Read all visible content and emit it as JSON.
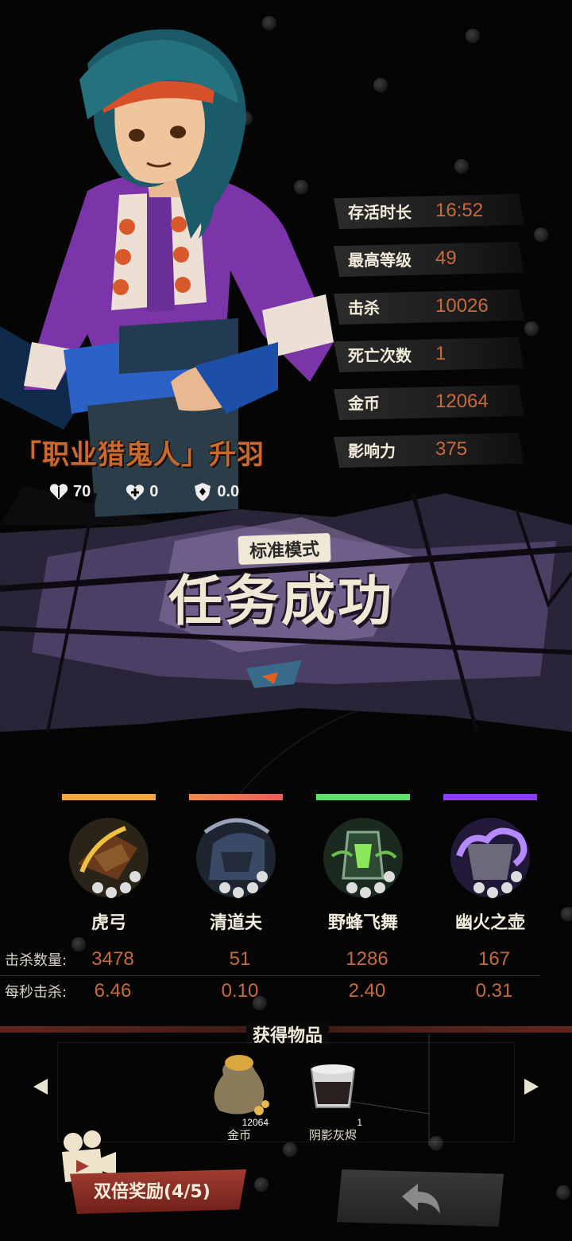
{
  "character": {
    "name": "「职业猎鬼人」升羽",
    "attributes": [
      {
        "icon": "heart-shield-icon",
        "value": "70"
      },
      {
        "icon": "heal-cross-icon",
        "value": "0"
      },
      {
        "icon": "armor-shield-icon",
        "value": "0.0"
      }
    ]
  },
  "stats": [
    {
      "label": "存活时长",
      "value": "16:52"
    },
    {
      "label": "最高等级",
      "value": "49"
    },
    {
      "label": "击杀",
      "value": "10026"
    },
    {
      "label": "死亡次数",
      "value": "1"
    },
    {
      "label": "金币",
      "value": "12064"
    },
    {
      "label": "影响力",
      "value": "375"
    }
  ],
  "result": {
    "mode": "标准模式",
    "title": "任务成功"
  },
  "weapons": [
    {
      "name": "虎弓",
      "color": "#f4a83a",
      "kills": "3478",
      "kps": "6.46"
    },
    {
      "name": "清道夫",
      "color": "#f06a4a",
      "kills": "51",
      "kps": "0.10"
    },
    {
      "name": "野蜂飞舞",
      "color": "#5de26a",
      "kills": "1286",
      "kps": "2.40"
    },
    {
      "name": "幽火之壶",
      "color": "#8a3ef0",
      "kills": "167",
      "kps": "0.31"
    }
  ],
  "kill_table": {
    "kills_label": "击杀数量:",
    "kps_label": "每秒击杀:"
  },
  "items": {
    "title": "获得物品",
    "list": [
      {
        "name": "金币",
        "count": "12064",
        "icon": "coin-bag-icon"
      },
      {
        "name": "阴影灰烬",
        "count": "1",
        "icon": "ash-jar-icon"
      }
    ]
  },
  "buttons": {
    "double_reward": "双倍奖励(4/5)",
    "return_icon": "return-arrow-icon"
  }
}
